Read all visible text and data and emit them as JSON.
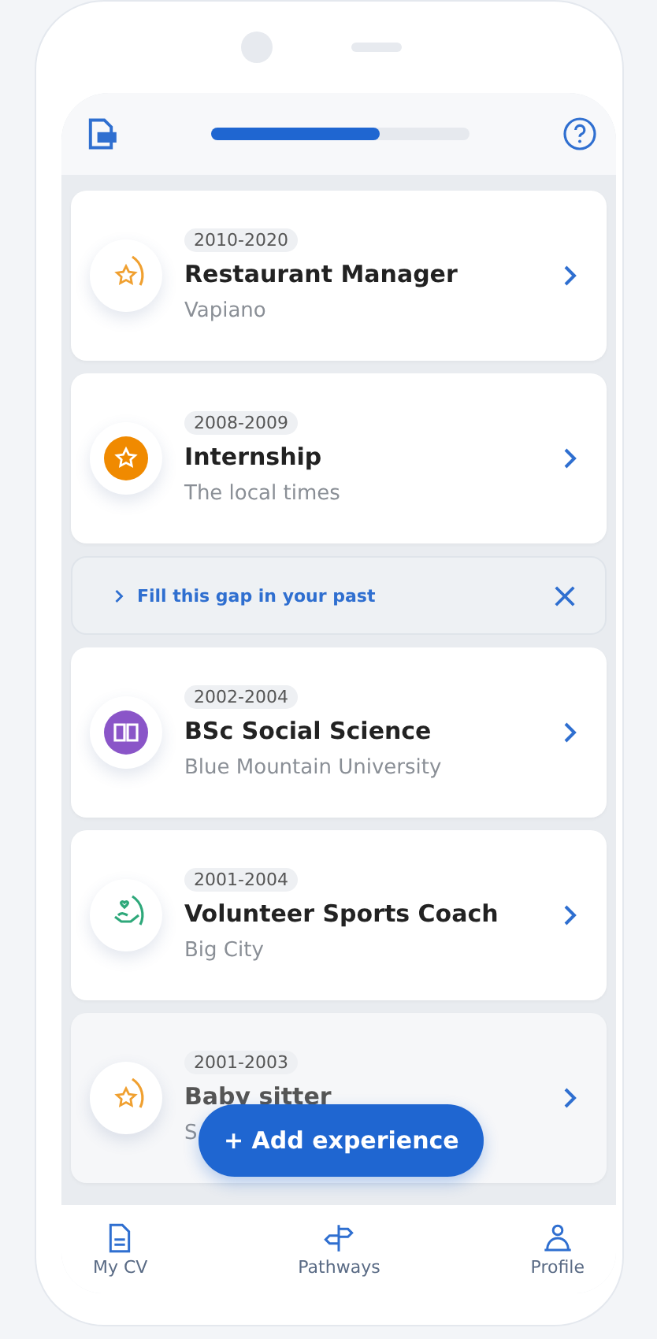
{
  "header": {
    "progress": {
      "level": 0.65
    }
  },
  "experiences": [
    {
      "kind": "job",
      "years": "2010-2020",
      "title": "Restaurant Manager",
      "subtitle": "Vapiano",
      "color": "#f0a030"
    },
    {
      "kind": "highlight",
      "years": "2008-2009",
      "title": "Internship",
      "subtitle": "The local times",
      "color": "#f08a00"
    },
    {
      "kind": "gap",
      "label": "Fill this gap in your past"
    },
    {
      "kind": "education",
      "years": "2002-2004",
      "title": "BSc Social Science",
      "subtitle": "Blue Mountain University",
      "color": "#8a55c8"
    },
    {
      "kind": "volunteer",
      "years": "2001-2004",
      "title": "Volunteer Sports Coach",
      "subtitle": "Big City",
      "color": "#2ea87a"
    },
    {
      "kind": "job",
      "years": "2001-2003",
      "title": "Baby sitter",
      "subtitle": "S",
      "color": "#f0a030"
    }
  ],
  "add_button": {
    "label": "+ Add experience"
  },
  "nav": [
    {
      "label": "My CV"
    },
    {
      "label": "Pathways"
    },
    {
      "label": "Profile"
    }
  ]
}
